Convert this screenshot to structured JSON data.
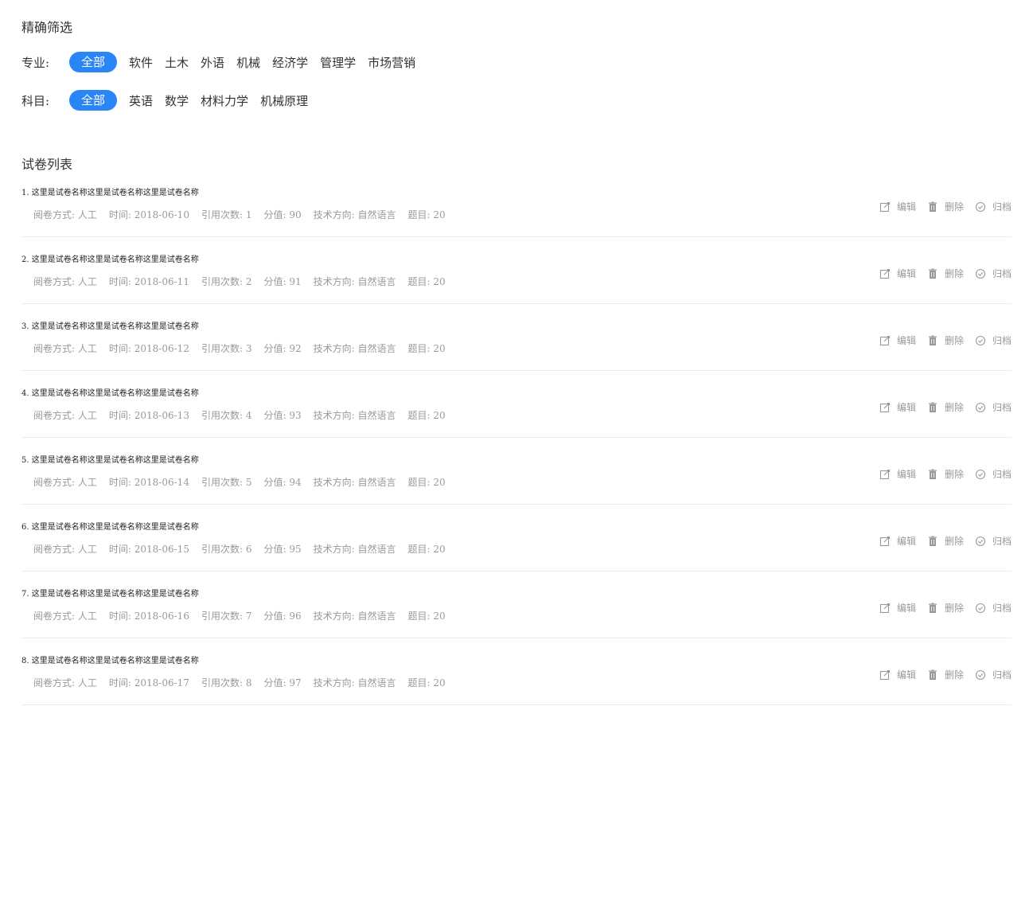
{
  "filter": {
    "title": "精确筛选",
    "major": {
      "label": "专业:",
      "options": [
        "全部",
        "软件",
        "土木",
        "外语",
        "机械",
        "经济学",
        "管理学",
        "市场营销"
      ],
      "selected": "全部"
    },
    "subject": {
      "label": "科目:",
      "options": [
        "全部",
        "英语",
        "数学",
        "材料力学",
        "机械原理"
      ],
      "selected": "全部"
    },
    "accent_color": "#2a86f6"
  },
  "list": {
    "title": "试卷列表",
    "actions": {
      "edit": "编辑",
      "delete": "删除",
      "archive": "归档"
    },
    "meta_labels": {
      "method": "阅卷方式:",
      "time": "时间:",
      "citations": "引用次数:",
      "score": "分值:",
      "direction": "技术方向:",
      "questions": "题目:"
    },
    "items": [
      {
        "index": "1.",
        "name": "这里是试卷名称这里是试卷名称这里是试卷名称",
        "method": "人工",
        "time": "2018-06-10",
        "citations": "1",
        "score": "90",
        "direction": "自然语言",
        "questions": "20"
      },
      {
        "index": "2.",
        "name": "这里是试卷名称这里是试卷名称这里是试卷名称",
        "method": "人工",
        "time": "2018-06-11",
        "citations": "2",
        "score": "91",
        "direction": "自然语言",
        "questions": "20"
      },
      {
        "index": "3.",
        "name": "这里是试卷名称这里是试卷名称这里是试卷名称",
        "method": "人工",
        "time": "2018-06-12",
        "citations": "3",
        "score": "92",
        "direction": "自然语言",
        "questions": "20"
      },
      {
        "index": "4.",
        "name": "这里是试卷名称这里是试卷名称这里是试卷名称",
        "method": "人工",
        "time": "2018-06-13",
        "citations": "4",
        "score": "93",
        "direction": "自然语言",
        "questions": "20"
      },
      {
        "index": "5.",
        "name": "这里是试卷名称这里是试卷名称这里是试卷名称",
        "method": "人工",
        "time": "2018-06-14",
        "citations": "5",
        "score": "94",
        "direction": "自然语言",
        "questions": "20"
      },
      {
        "index": "6.",
        "name": "这里是试卷名称这里是试卷名称这里是试卷名称",
        "method": "人工",
        "time": "2018-06-15",
        "citations": "6",
        "score": "95",
        "direction": "自然语言",
        "questions": "20"
      },
      {
        "index": "7.",
        "name": "这里是试卷名称这里是试卷名称这里是试卷名称",
        "method": "人工",
        "time": "2018-06-16",
        "citations": "7",
        "score": "96",
        "direction": "自然语言",
        "questions": "20"
      },
      {
        "index": "8.",
        "name": "这里是试卷名称这里是试卷名称这里是试卷名称",
        "method": "人工",
        "time": "2018-06-17",
        "citations": "8",
        "score": "97",
        "direction": "自然语言",
        "questions": "20"
      }
    ]
  },
  "icons": {
    "edit": "edit-icon",
    "delete": "trash-icon",
    "archive": "check-circle-icon"
  }
}
